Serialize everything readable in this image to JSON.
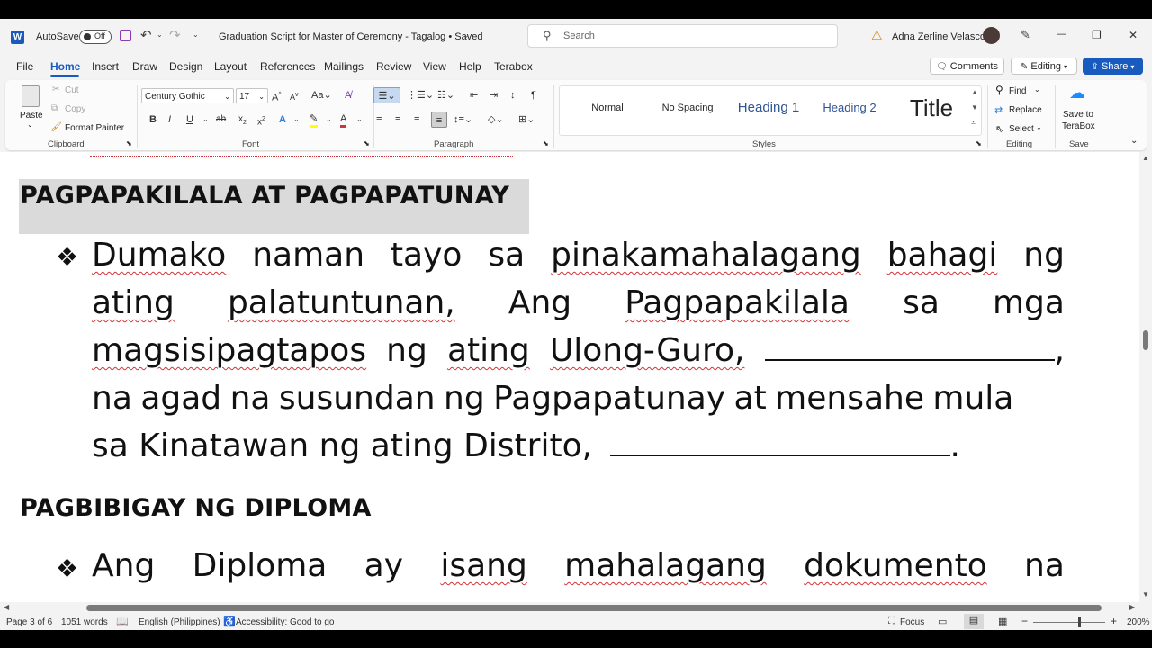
{
  "titlebar": {
    "app_icon": "word-icon",
    "autosave_label": "AutoSave",
    "autosave_state": "Off",
    "doc_title": "Graduation Script for Master of Ceremony - Tagalog • Saved",
    "search_placeholder": "Search",
    "user_name": "Adna Zerline Velasco",
    "minimize": "—",
    "restore": "❐",
    "close": "✕"
  },
  "menu": {
    "items": [
      "File",
      "Home",
      "Insert",
      "Draw",
      "Design",
      "Layout",
      "References",
      "Mailings",
      "Review",
      "View",
      "Help",
      "Terabox"
    ],
    "active": "Home",
    "comments_label": "Comments",
    "editing_label": "Editing",
    "share_label": "Share"
  },
  "ribbon": {
    "clipboard": {
      "paste": "Paste",
      "cut": "Cut",
      "copy": "Copy",
      "format_painter": "Format Painter",
      "label": "Clipboard"
    },
    "font": {
      "font_name": "Century Gothic",
      "font_size": "17",
      "label": "Font"
    },
    "paragraph": {
      "label": "Paragraph"
    },
    "styles": {
      "items": [
        "Normal",
        "No Spacing",
        "Heading 1",
        "Heading 2",
        "Title"
      ],
      "label": "Styles"
    },
    "editing": {
      "find": "Find",
      "replace": "Replace",
      "select": "Select",
      "label": "Editing"
    },
    "save": {
      "line1": "Save to",
      "line2": "TeraBox",
      "label": "Save"
    }
  },
  "document": {
    "heading1": "PAGPAPAKILALA AT PAGPAPATUNAY",
    "para1": {
      "line1": [
        "Dumako",
        "naman",
        "tayo",
        "sa",
        "pinakamahalagang",
        "bahagi",
        "ng"
      ],
      "line2": [
        "ating",
        "palatuntunan,",
        "Ang",
        "Pagpapakilala",
        "sa",
        "mga"
      ],
      "line3": [
        "magsisipagtapos",
        "ng",
        "ating",
        "Ulong-Guro,"
      ],
      "line3_end": ",",
      "line4": "na agad na susundan ng Pagpapatunay at mensahe mula",
      "line5": "sa Kinatawan ng ating Distrito,",
      "line5_end": "."
    },
    "heading2": "PAGBIBIGAY NG DIPLOMA",
    "para2": {
      "line1": [
        "Ang",
        "Diploma",
        "ay",
        "isang",
        "mahalagang",
        "dokumento",
        "na"
      ]
    },
    "bullet_glyph": "❖"
  },
  "status": {
    "page": "Page 3 of 6",
    "words": "1051 words",
    "language": "English (Philippines)",
    "accessibility": "Accessibility: Good to go",
    "focus": "Focus",
    "zoom": "200%"
  }
}
